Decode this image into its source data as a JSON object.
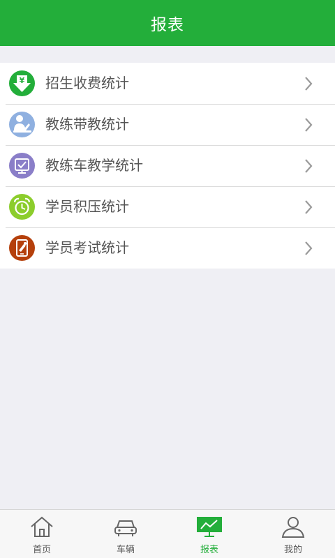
{
  "header": {
    "title": "报表"
  },
  "colors": {
    "brand": "#23ae3a",
    "icon_green": "#23ae3a",
    "icon_blue": "#8fb0e0",
    "icon_purple": "#8a7ec8",
    "icon_lime": "#8ccd2c",
    "icon_brown": "#b5400c"
  },
  "list": {
    "items": [
      {
        "label": "招生收费统计",
        "icon": "yen-download-icon"
      },
      {
        "label": "教练带教统计",
        "icon": "teacher-icon"
      },
      {
        "label": "教练车教学统计",
        "icon": "board-check-icon"
      },
      {
        "label": "学员积压统计",
        "icon": "alarm-clock-icon"
      },
      {
        "label": "学员考试统计",
        "icon": "phone-exam-icon"
      }
    ]
  },
  "tabbar": {
    "items": [
      {
        "label": "首页",
        "icon": "home-icon",
        "active": false
      },
      {
        "label": "车辆",
        "icon": "car-icon",
        "active": false
      },
      {
        "label": "报表",
        "icon": "chart-board-icon",
        "active": true
      },
      {
        "label": "我的",
        "icon": "user-icon",
        "active": false
      }
    ]
  }
}
